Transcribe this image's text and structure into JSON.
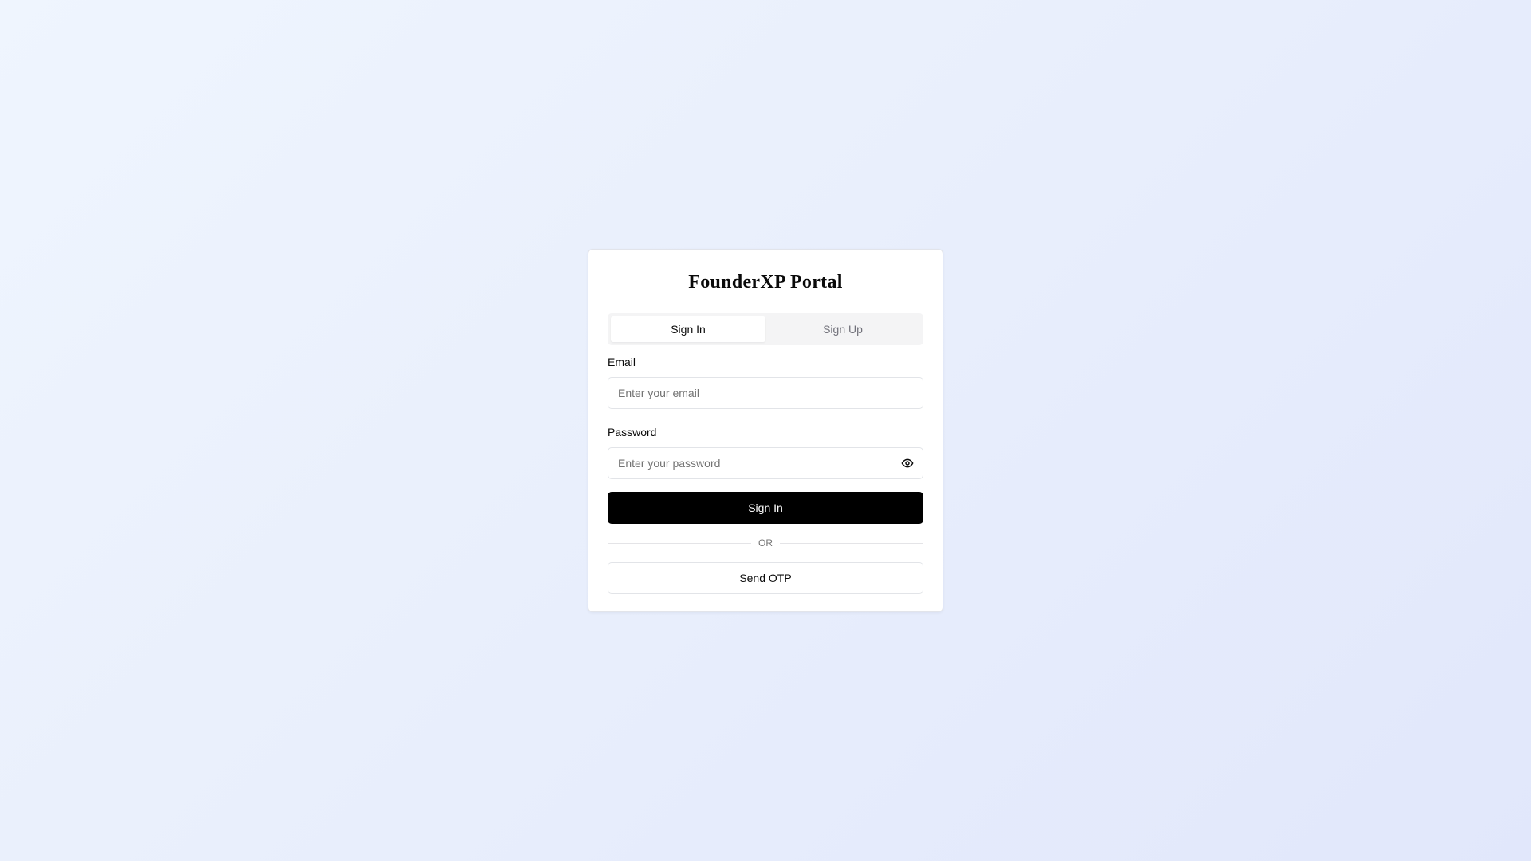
{
  "portal": {
    "title": "FounderXP Portal"
  },
  "tabs": [
    {
      "label": "Sign In",
      "active": true
    },
    {
      "label": "Sign Up",
      "active": false
    }
  ],
  "form": {
    "email": {
      "label": "Email",
      "value": "",
      "placeholder": "Enter your email"
    },
    "password": {
      "label": "Password",
      "value": "",
      "placeholder": "Enter your password",
      "toggle_icon": "eye-icon"
    },
    "submit_label": "Sign In",
    "divider_text": "OR",
    "otp_label": "Send OTP"
  },
  "colors": {
    "primary_button_bg": "#000000",
    "primary_button_text": "#ffffff",
    "muted_text": "#737373",
    "tab_track_bg": "#f4f4f5"
  }
}
